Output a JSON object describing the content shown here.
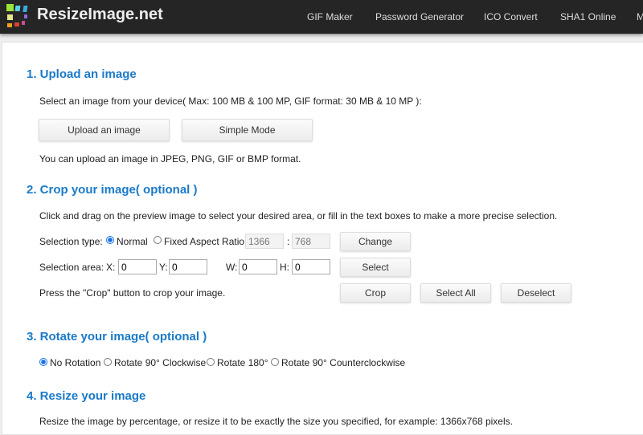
{
  "header": {
    "brand": "ResizeImage.net",
    "nav": [
      "GIF Maker",
      "Password Generator",
      "ICO Convert",
      "SHA1 Online",
      "M"
    ]
  },
  "s1": {
    "title": "1. Upload an image",
    "desc": "Select an image from your device( Max: 100 MB & 100 MP, GIF format: 30 MB & 10 MP ):",
    "upload": "Upload an image",
    "simple": "Simple Mode",
    "note": "You can upload an image in JPEG, PNG, GIF or BMP format."
  },
  "s2": {
    "title": "2. Crop your image( optional )",
    "desc": "Click and drag on the preview image to select your desired area, or fill in the text boxes to make a more precise selection.",
    "sel_type": "Selection type:",
    "normal": "Normal",
    "fixed": "Fixed Aspect Ratio",
    "ratio_w": "1366",
    "colon": ":",
    "ratio_h": "768",
    "change": "Change",
    "sel_area": "Selection area:",
    "x_label": "X:",
    "x": "0",
    "y_label": "Y:",
    "y": "0",
    "w_label": "W:",
    "w": "0",
    "h_label": "H:",
    "h": "0",
    "select": "Select",
    "press": "Press the \"Crop\" button to crop your image.",
    "crop": "Crop",
    "select_all": "Select All",
    "deselect": "Deselect"
  },
  "s3": {
    "title": "3. Rotate your image( optional )",
    "options": [
      "No Rotation",
      "Rotate 90° Clockwise",
      "Rotate 180°",
      "Rotate 90° Counterclockwise"
    ],
    "selected": "No Rotation"
  },
  "s4": {
    "title": "4. Resize your image",
    "desc": "Resize the image by percentage, or resize it to be exactly the size you specified, for example: 1366x768 pixels."
  }
}
